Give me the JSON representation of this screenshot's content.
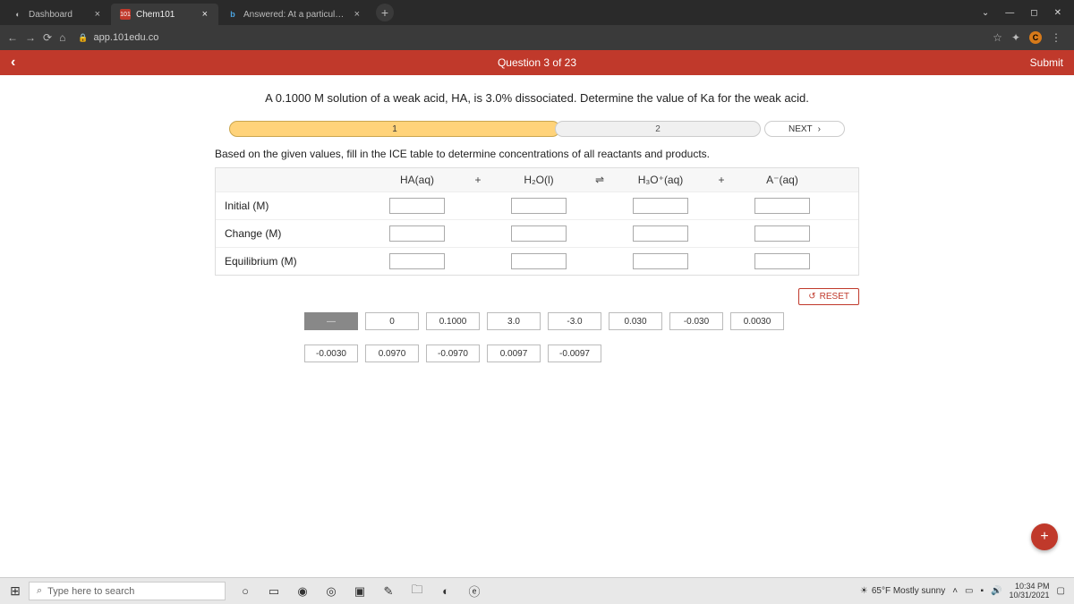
{
  "browser": {
    "tabs": [
      {
        "title": "Dashboard",
        "favicon": "◐"
      },
      {
        "title": "Chem101",
        "favicon": "101"
      },
      {
        "title": "Answered: At a particular tempe",
        "favicon": "b"
      }
    ],
    "url": "app.101edu.co"
  },
  "header": {
    "question_counter": "Question 3 of 23",
    "submit_label": "Submit"
  },
  "prompt": "A 0.1000 M solution of a weak acid, HA, is 3.0% dissociated. Determine the value of Ka for the weak acid.",
  "steps": {
    "s1": "1",
    "s2": "2",
    "next": "NEXT"
  },
  "instruction": "Based on the given values, fill in the ICE table to determine concentrations of all reactants and products.",
  "ice": {
    "col1": "HA(aq)",
    "plus": "+",
    "col2": "H₂O(l)",
    "eq": "⇌",
    "col3": "H₃O⁺(aq)",
    "col4": "A⁻(aq)",
    "rows": [
      "Initial (M)",
      "Change (M)",
      "Equilibrium (M)"
    ]
  },
  "reset": "RESET",
  "tiles": [
    "—",
    "0",
    "0.1000",
    "3.0",
    "-3.0",
    "0.030",
    "-0.030",
    "0.0030",
    "-0.0030",
    "0.0970",
    "-0.0970",
    "0.0097",
    "-0.0097"
  ],
  "taskbar": {
    "search_placeholder": "Type here to search",
    "weather": "65°F Mostly sunny",
    "time": "10:34 PM",
    "date": "10/31/2021"
  }
}
